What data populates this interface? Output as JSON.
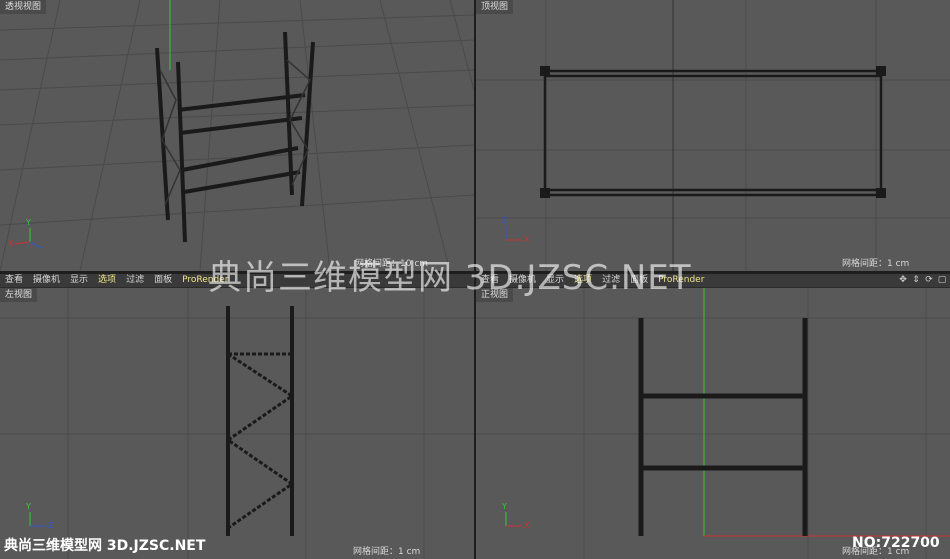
{
  "viewports": {
    "perspective": {
      "label": "透视视图",
      "grid_info": "网格间距：10 cm"
    },
    "top": {
      "label": "顶视图",
      "grid_info": "网格间距：1 cm"
    },
    "left": {
      "label": "左视图",
      "grid_info": "网格间距：1 cm"
    },
    "front": {
      "label": "正视图",
      "grid_info": "网格间距：1 cm"
    }
  },
  "menu_left": [
    "查看",
    "摄像机",
    "显示",
    "选项",
    "过滤",
    "面板",
    "ProRender"
  ],
  "menu_right": [
    "查看",
    "摄像机",
    "显示",
    "选项",
    "过滤",
    "面板",
    "ProRender"
  ],
  "nav_icons": [
    "move-icon",
    "zoom-icon",
    "rotate-icon",
    "maximize-icon"
  ],
  "axes": {
    "x": "X",
    "y": "Y",
    "z": "Z"
  },
  "watermark": "典尚三维模型网 3D.JZSC.NET",
  "bottom_watermark": "典尚三维模型网 3D.JZSC.NET",
  "item_number": "NO:722700",
  "colors": {
    "viewport_bg": "#595959",
    "grid": "#4a4a4a",
    "model": "#1a1a1a",
    "y_axis": "#33cc33",
    "x_axis": "#cc3333",
    "active_menu": "#f0e58a"
  }
}
